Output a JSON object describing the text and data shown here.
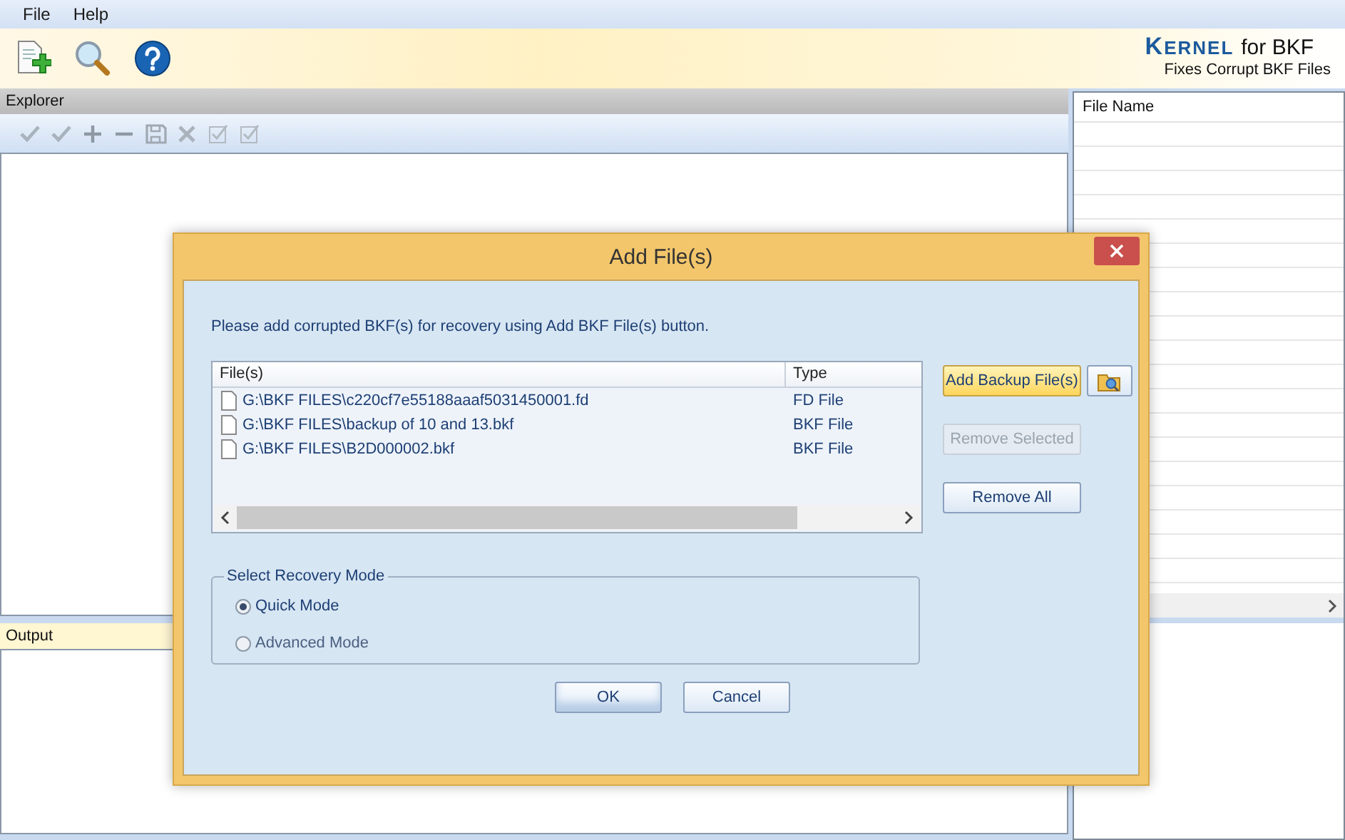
{
  "menu": [
    {
      "label": "File"
    },
    {
      "label": "Help"
    }
  ],
  "logo": {
    "brand": "KERNEL",
    "product": "for BKF",
    "tagline": "Fixes Corrupt BKF Files"
  },
  "explorer": {
    "title": "Explorer"
  },
  "output": {
    "title": "Output"
  },
  "file_list": {
    "columns": [
      "File Name"
    ]
  },
  "dialog": {
    "title": "Add File(s)",
    "instruction": "Please add corrupted BKF(s) for recovery using Add BKF File(s) button.",
    "table": {
      "columns": [
        "File(s)",
        "Type"
      ],
      "rows": [
        {
          "path": "G:\\BKF FILES\\c220cf7e55188aaaf5031450001.fd",
          "type": "FD File"
        },
        {
          "path": "G:\\BKF FILES\\backup of 10 and 13.bkf",
          "type": "BKF File"
        },
        {
          "path": "G:\\BKF FILES\\B2D000002.bkf",
          "type": "BKF File"
        }
      ]
    },
    "buttons": [
      {
        "label": "Add Backup File(s)",
        "kind": "highlighted",
        "disabled": false
      },
      {
        "label": "Remove Selected",
        "kind": "normal",
        "disabled": true
      },
      {
        "label": "Remove All",
        "kind": "normal",
        "disabled": false
      }
    ],
    "mode_group": {
      "title": "Select Recovery Mode",
      "options": [
        {
          "label": "Quick Mode",
          "selected": true
        },
        {
          "label": "Advanced Mode",
          "selected": false
        }
      ]
    },
    "actions": [
      {
        "label": "OK"
      },
      {
        "label": "Cancel"
      }
    ]
  }
}
